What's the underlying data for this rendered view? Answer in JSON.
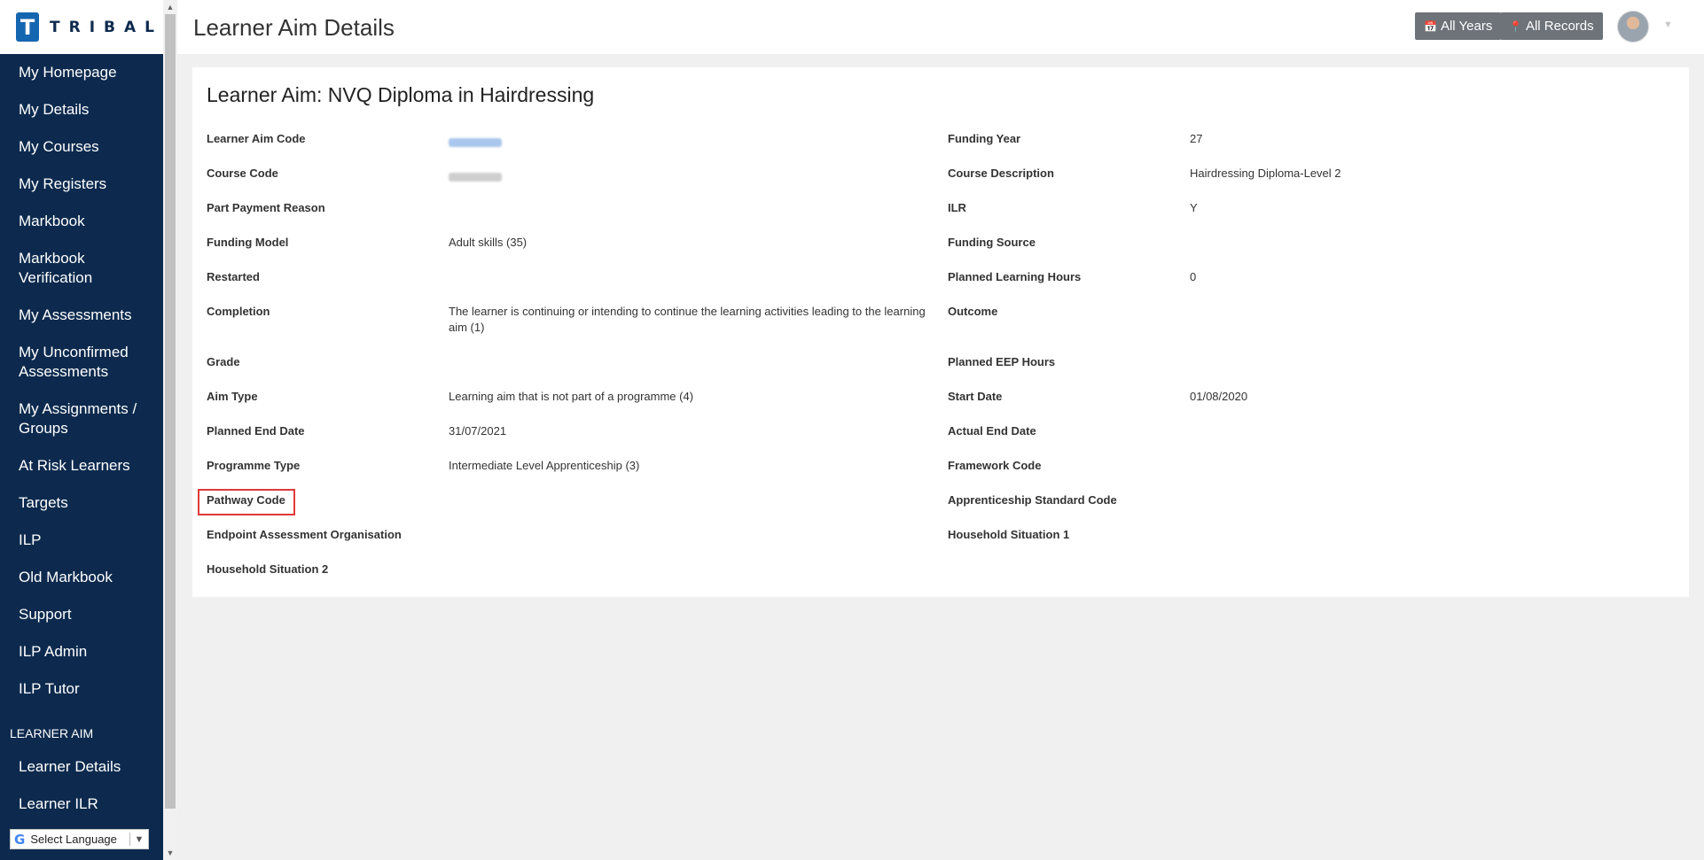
{
  "brand": {
    "logo_letter": "T",
    "logo_text": "TRIBAL"
  },
  "sidebar": {
    "items": [
      "My Homepage",
      "My Details",
      "My Courses",
      "My Registers",
      "Markbook",
      "Markbook Verification",
      "My Assessments",
      "My Unconfirmed Assessments",
      "My Assignments / Groups",
      "At Risk Learners",
      "Targets",
      "ILP",
      "Old Markbook",
      "Support",
      "ILP Admin",
      "ILP Tutor"
    ],
    "section_title": "LEARNER AIM",
    "section_items": [
      "Learner Details",
      "Learner ILR"
    ]
  },
  "language_selector": {
    "g_icon": "G",
    "label": "Select Language",
    "arrow": "▼"
  },
  "header": {
    "title": "Learner Aim Details",
    "all_years_label": "All Years",
    "all_records_label": "All Records",
    "calendar_icon": "📅",
    "pin_icon": "📍"
  },
  "card": {
    "title": "Learner Aim: NVQ Diploma in Hairdressing",
    "left_fields": [
      {
        "label": "Learner Aim Code",
        "value": ""
      },
      {
        "label": "Course Code",
        "value": ""
      },
      {
        "label": "Part Payment Reason",
        "value": ""
      },
      {
        "label": "Funding Model",
        "value": "Adult skills (35)"
      },
      {
        "label": "Restarted",
        "value": ""
      },
      {
        "label": "Completion",
        "value": "The learner is continuing or intending to continue the learning activities leading to the learning aim (1)"
      },
      {
        "label": "Grade",
        "value": ""
      },
      {
        "label": "Aim Type",
        "value": "Learning aim that is not part of a programme (4)"
      },
      {
        "label": "Planned End Date",
        "value": "31/07/2021"
      },
      {
        "label": "Programme Type",
        "value": "Intermediate Level Apprenticeship (3)"
      },
      {
        "label": "Pathway Code",
        "value": ""
      },
      {
        "label": "Endpoint Assessment Organisation",
        "value": ""
      },
      {
        "label": "Household Situation 2",
        "value": ""
      }
    ],
    "right_fields": [
      {
        "label": "Funding Year",
        "value": "27"
      },
      {
        "label": "Course Description",
        "value": "Hairdressing Diploma-Level 2"
      },
      {
        "label": "ILR",
        "value": "Y"
      },
      {
        "label": "Funding Source",
        "value": ""
      },
      {
        "label": "Planned Learning Hours",
        "value": "0"
      },
      {
        "label": "Outcome",
        "value": ""
      },
      {
        "label": "Planned EEP Hours",
        "value": ""
      },
      {
        "label": "Start Date",
        "value": "01/08/2020"
      },
      {
        "label": "Actual End Date",
        "value": ""
      },
      {
        "label": "Framework Code",
        "value": ""
      },
      {
        "label": "Apprenticeship Standard Code",
        "value": ""
      },
      {
        "label": "Household Situation 1",
        "value": ""
      }
    ]
  },
  "colors": {
    "sidebar_bg": "#0d2a4e",
    "button_bg": "#6d7379",
    "highlight": "#e03a3a",
    "logo_blue": "#1566b0"
  }
}
